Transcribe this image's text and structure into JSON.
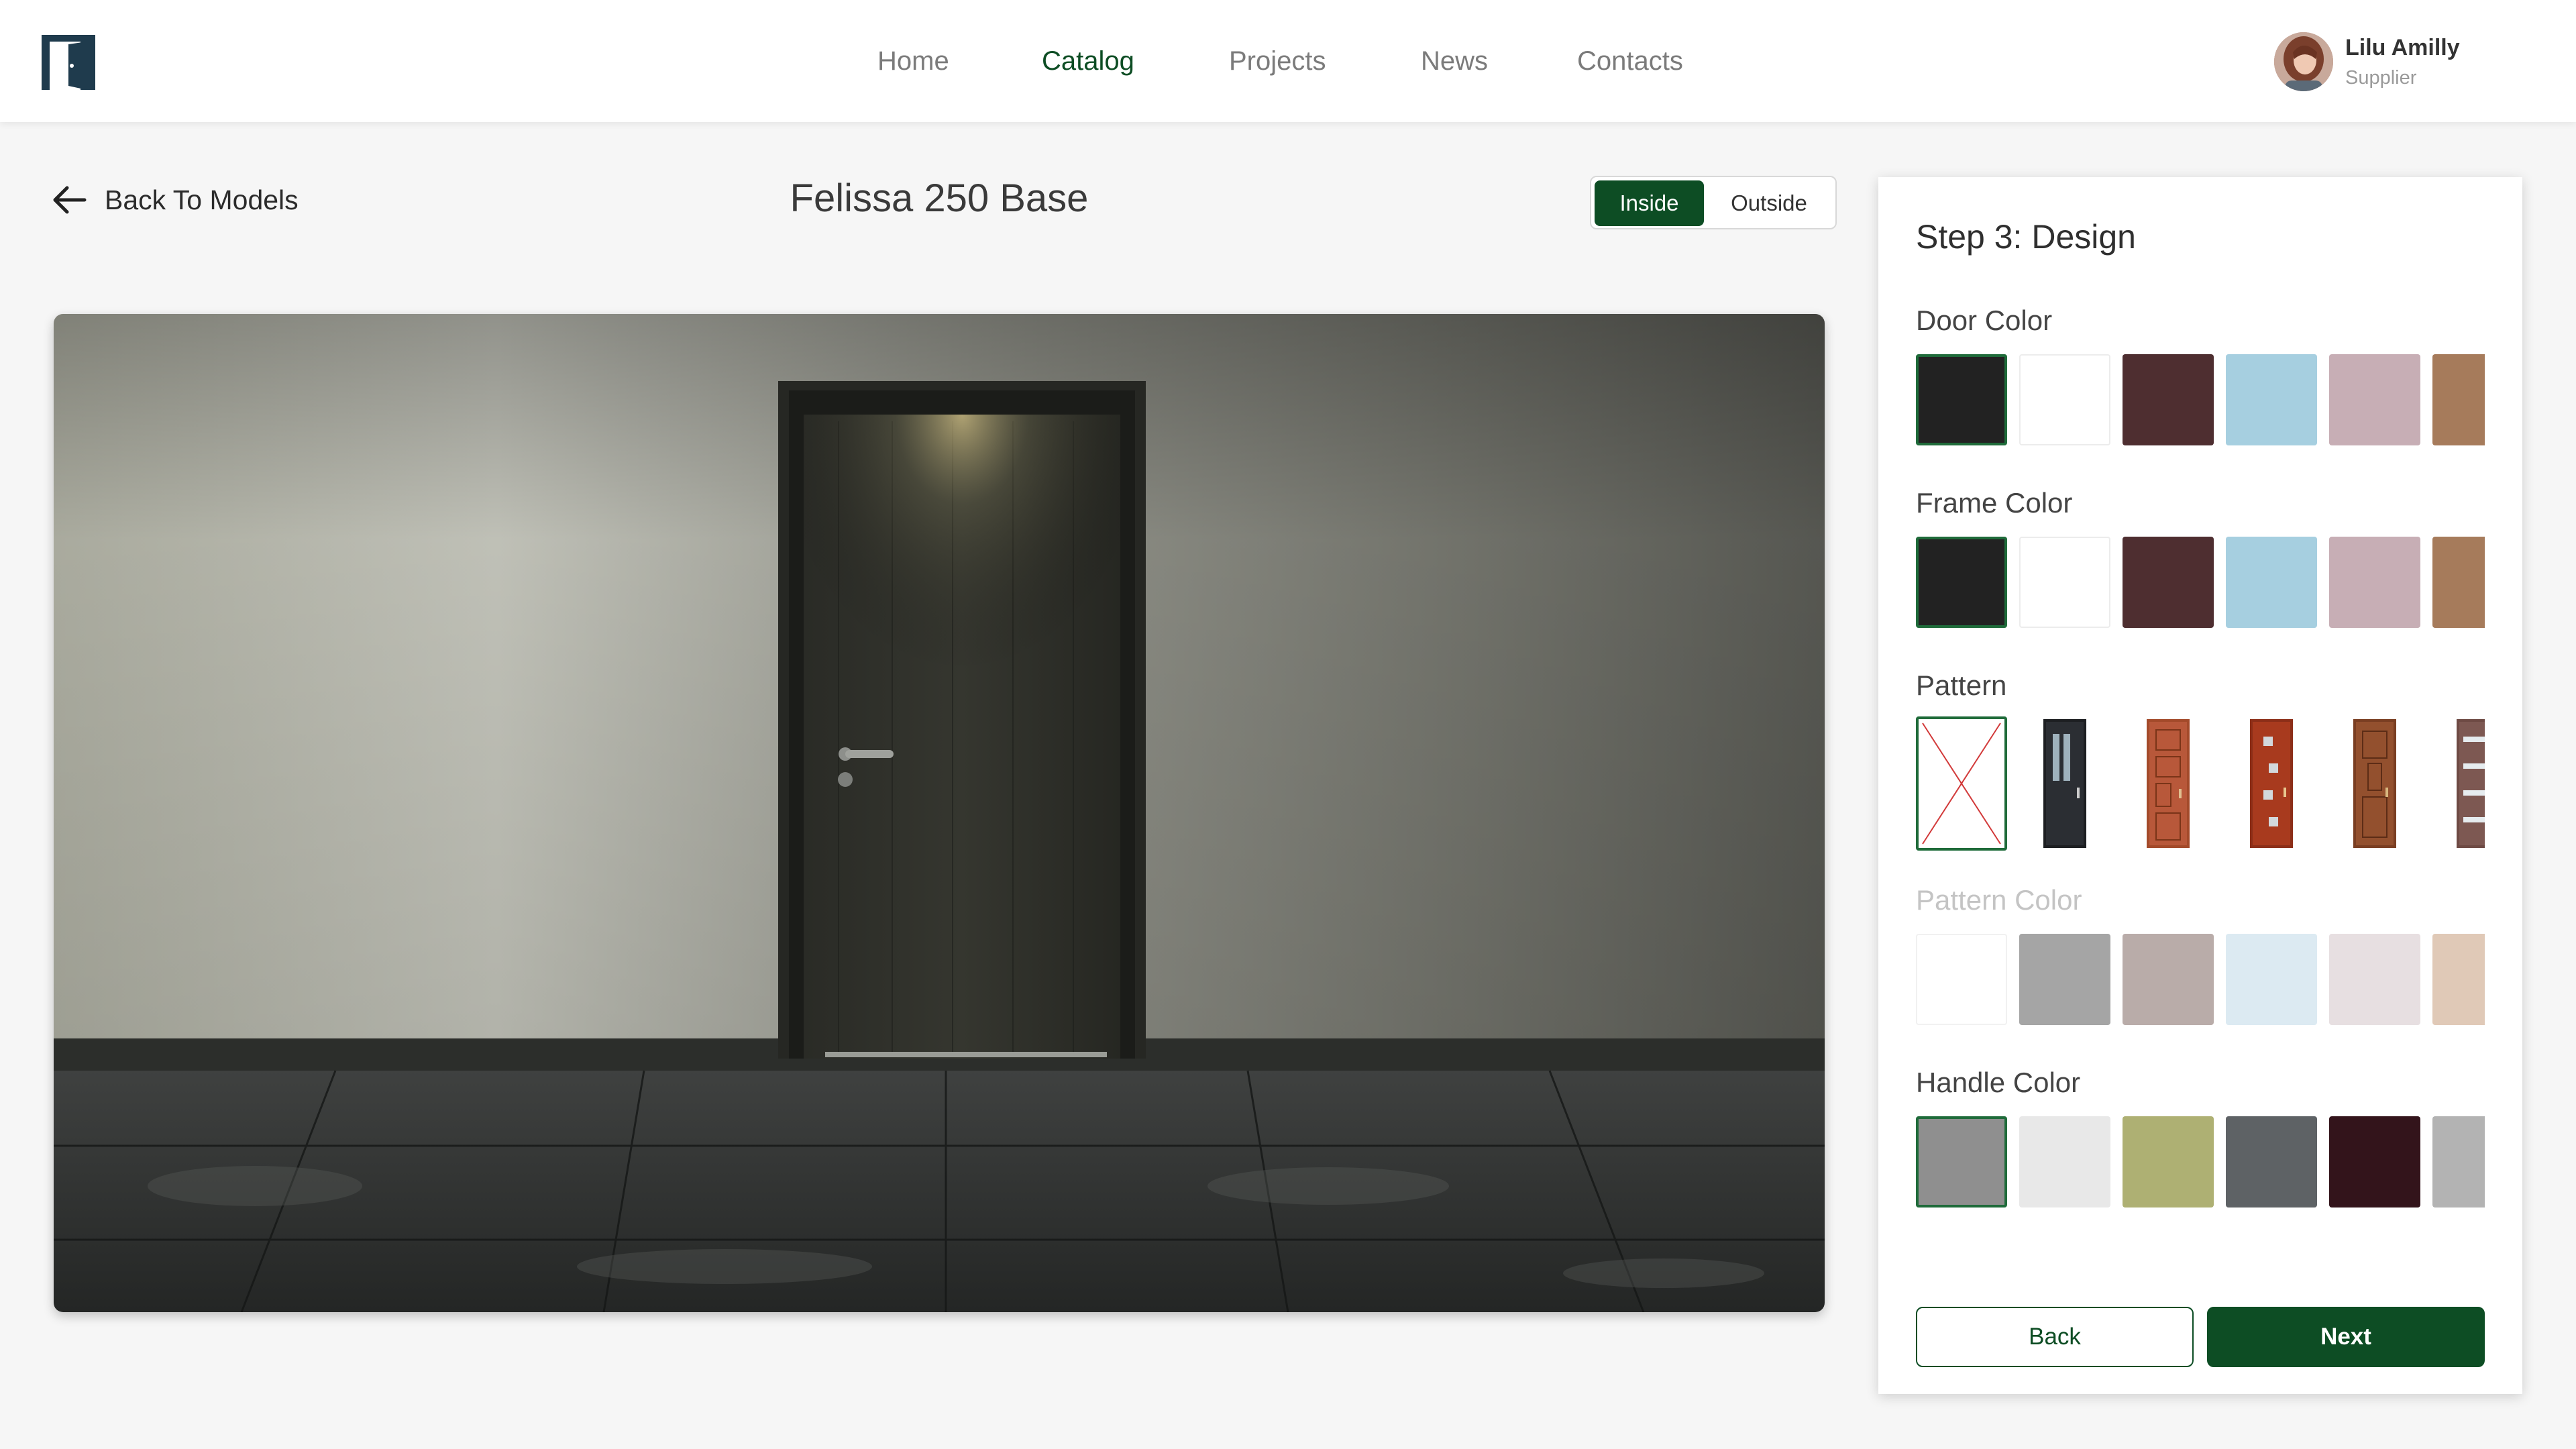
{
  "nav": {
    "items": [
      {
        "label": "Home",
        "active": false
      },
      {
        "label": "Catalog",
        "active": true
      },
      {
        "label": "Projects",
        "active": false
      },
      {
        "label": "News",
        "active": false
      },
      {
        "label": "Contacts",
        "active": false
      }
    ]
  },
  "user": {
    "name": "Lilu Amilly",
    "role": "Supplier"
  },
  "back_link": "Back To Models",
  "model_title": "Felissa 250 Base",
  "view_toggle": {
    "options": [
      "Inside",
      "Outside"
    ],
    "selected": "Inside"
  },
  "panel": {
    "step_title": "Step 3: Design",
    "door_color": {
      "label": "Door Color",
      "swatches": [
        "#222222",
        "#ffffff",
        "#4e2e30",
        "#a6cfe0",
        "#c7aeb5",
        "#a67b5b"
      ],
      "selected_index": 0
    },
    "frame_color": {
      "label": "Frame Color",
      "swatches": [
        "#222222",
        "#ffffff",
        "#4e2e30",
        "#a6cfe0",
        "#c7aeb5",
        "#a67b5b"
      ],
      "selected_index": 0
    },
    "pattern": {
      "label": "Pattern",
      "options": [
        "none-icon",
        "glass-panel-door-icon",
        "geometric-panel-door-icon",
        "square-inset-door-icon",
        "raised-panel-door-icon",
        "stripe-glass-door-icon"
      ],
      "selected_index": 0
    },
    "pattern_color": {
      "label": "Pattern Color",
      "disabled": true,
      "swatches": [
        "#ffffff",
        "#a5a5a5",
        "#b9aca9",
        "#dceaf2",
        "#e7dfe1",
        "#e0c9b7"
      ]
    },
    "handle_color": {
      "label": "Handle Color",
      "swatches": [
        "#8f8f8f",
        "#e8e8e8",
        "#aeb073",
        "#5e6265",
        "#33141b",
        "#b3b3b3"
      ],
      "selected_index": 0
    },
    "back_label": "Back",
    "next_label": "Next"
  },
  "colors": {
    "brand": "#0d4d24",
    "nav_active": "#0d4d24"
  }
}
